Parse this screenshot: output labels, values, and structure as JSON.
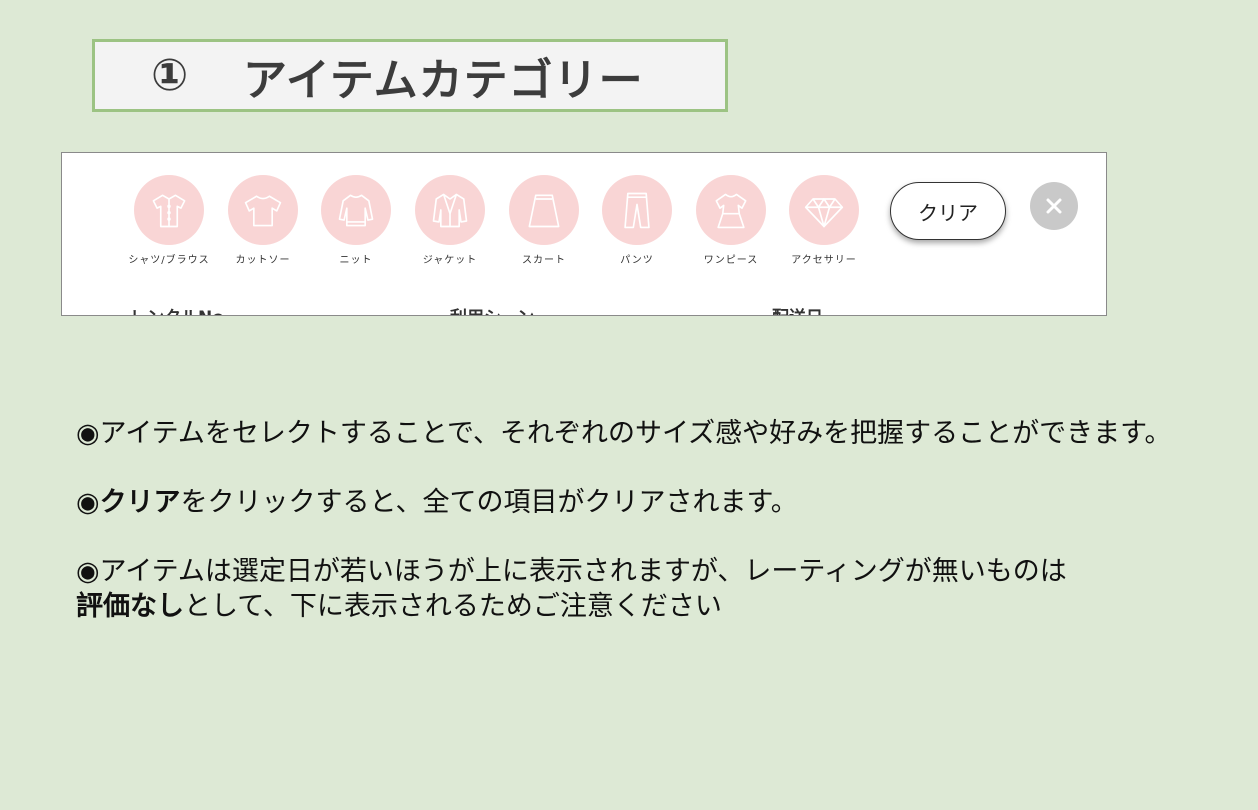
{
  "header": {
    "number": "①",
    "title": "アイテムカテゴリー"
  },
  "categories": [
    {
      "label": "シャツ/ブラウス",
      "icon": "shirt-icon"
    },
    {
      "label": "カットソー",
      "icon": "tshirt-icon"
    },
    {
      "label": "ニット",
      "icon": "knit-icon"
    },
    {
      "label": "ジャケット",
      "icon": "jacket-icon"
    },
    {
      "label": "スカート",
      "icon": "skirt-icon"
    },
    {
      "label": "パンツ",
      "icon": "pants-icon"
    },
    {
      "label": "ワンピース",
      "icon": "dress-icon"
    },
    {
      "label": "アクセサリー",
      "icon": "diamond-icon"
    }
  ],
  "clear_label": "クリア",
  "columns": {
    "rental": "レンタルNo",
    "scene": "利用シーン",
    "delivery": "配送日"
  },
  "notes": {
    "n1": "◉アイテムをセレクトすることで、それぞれのサイズ感や好みを把握することができます。",
    "n2_prefix": "◉",
    "n2_bold": "クリア",
    "n2_rest": "をクリックすると、全ての項目がクリアされます。",
    "n3_line1": "◉アイテムは選定日が若いほうが上に表示されますが、レーティングが無いものは",
    "n3_bold": "評価なし",
    "n3_rest": "として、下に表示されるためご注意ください"
  },
  "colors": {
    "background": "#dde9d5",
    "title_border": "#9cc383",
    "category_circle": "#f9d5d5",
    "close_button": "#c9c9c9"
  }
}
